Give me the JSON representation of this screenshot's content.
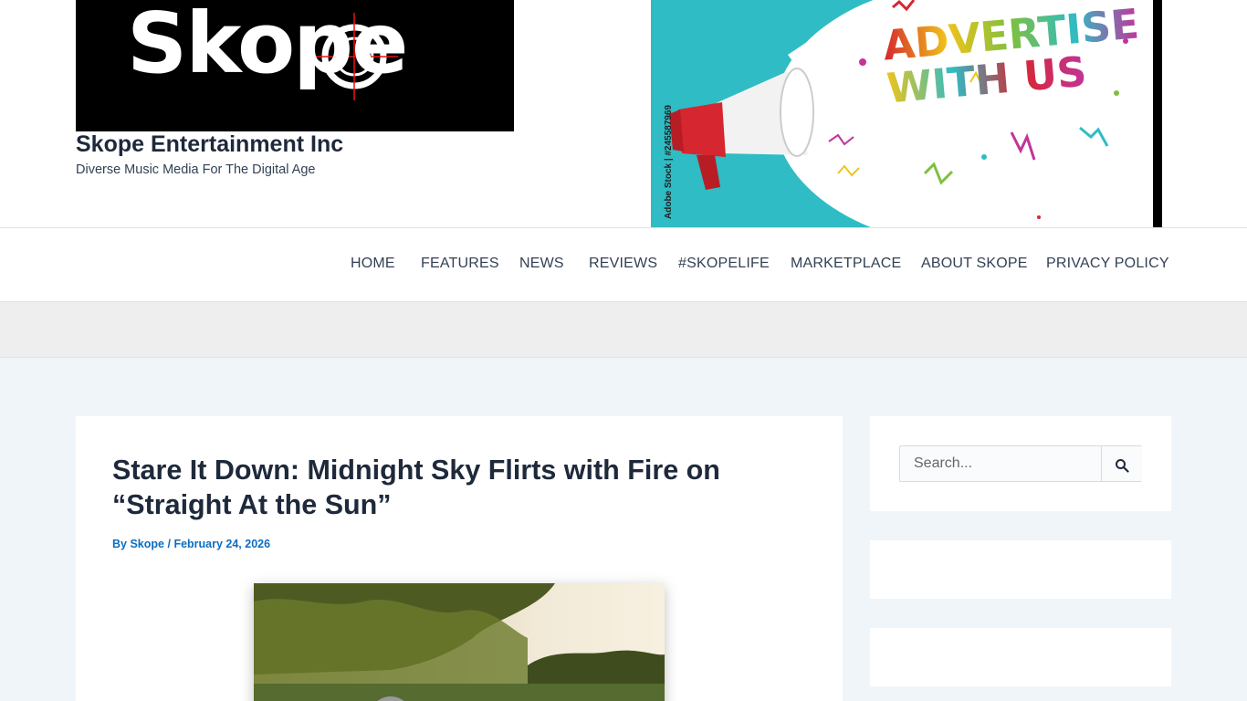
{
  "header": {
    "logo_text": "Skope",
    "site_title": "Skope Entertainment Inc",
    "tagline": "Diverse Music Media For The Digital Age"
  },
  "ad_banner": {
    "headline_line1": "ADVERTISE",
    "headline_line2": "WITH US",
    "stock_id": "Adobe Stock | #245587969",
    "watermark": "Adobe Stock",
    "colors": {
      "background": "#2fbcc4",
      "megaphone_red": "#d6262f"
    }
  },
  "nav": {
    "items": [
      {
        "label": "HOME"
      },
      {
        "label": "FEATURES"
      },
      {
        "label": "NEWS"
      },
      {
        "label": "REVIEWS"
      },
      {
        "label": "#SKOPELIFE"
      },
      {
        "label": "MARKETPLACE"
      },
      {
        "label": "ABOUT SKOPE"
      },
      {
        "label": "PRIVACY POLICY"
      }
    ]
  },
  "article": {
    "title": "Stare It Down: Midnight Sky Flirts with Fire on “Straight At the Sun”",
    "meta_by": "By",
    "author": "Skope",
    "separator": "/",
    "date": "February 24, 2026"
  },
  "sidebar": {
    "search": {
      "placeholder": "Search...",
      "button_icon": "search-icon"
    }
  },
  "colors": {
    "link": "#0c6dc2",
    "page_bg": "#f0f5fa",
    "heading": "#1e293b"
  }
}
